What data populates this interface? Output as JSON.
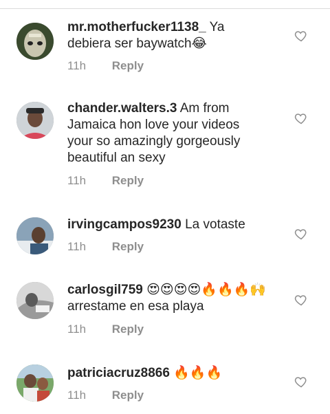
{
  "comments": [
    {
      "username": "mr.motherfucker1138_",
      "text": "Ya debiera ser baywatch😂",
      "time": "11h",
      "reply": "Reply",
      "avatar_colors": [
        "#3a4a2e",
        "#c9c6b0"
      ]
    },
    {
      "username": "chander.walters.3",
      "text": "Am from Jamaica hon love your videos your so amazingly gorgeously beautiful an sexy",
      "time": "11h",
      "reply": "Reply",
      "avatar_colors": [
        "#6a4a3a",
        "#d8485a"
      ]
    },
    {
      "username": "irvingcampos9230",
      "text": "La votaste",
      "time": "11h",
      "reply": "Reply",
      "avatar_colors": [
        "#8aa3b8",
        "#5a4030"
      ]
    },
    {
      "username": "carlosgil759",
      "text": "😍😍😍😍🔥🔥🔥🙌arrestame en esa playa",
      "time": "11h",
      "reply": "Reply",
      "avatar_colors": [
        "#9a9a9a",
        "#f2f2f2"
      ]
    },
    {
      "username": "patriciacruz8866",
      "text": "🔥🔥🔥",
      "time": "11h",
      "reply": "Reply",
      "avatar_colors": [
        "#7aa86a",
        "#c44a3a"
      ]
    }
  ]
}
